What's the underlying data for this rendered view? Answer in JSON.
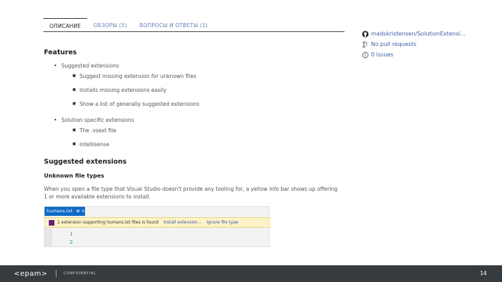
{
  "tabs": [
    {
      "label": "ОПИСАНИЕ",
      "active": true
    },
    {
      "label": "ОБЗОРЫ (5)",
      "active": false
    },
    {
      "label": "ВОПРОСЫ И ОТВЕТЫ (1)",
      "active": false
    }
  ],
  "sidebar": {
    "repo": "madskristensen/SolutionExtensi...",
    "pulls": "No pull requests",
    "issues": "0 issues"
  },
  "features": {
    "title": "Features",
    "groups": [
      {
        "label": "Suggested extensions",
        "items": [
          "Suggest missing extension for unknown files",
          "Installs missing extensions easily",
          "Show a list of generally suggested extensions"
        ]
      },
      {
        "label": "Solution specific extensions",
        "items": [
          "The .vsext file",
          "Intellisense"
        ]
      }
    ]
  },
  "suggested": {
    "title": "Suggested extensions",
    "subtitle": "Unknown file types",
    "description": "When you open a file type that Visual Studio doesn't provide any tooling for, a yellow info bar shows up offering 1 or more available extensions to install."
  },
  "screenshot": {
    "tab_label": "humans.txt",
    "tab_glyph": "⊕ ×",
    "bar_text": "1 extension supporting humans.txt files is found",
    "install_link": "Install extension...",
    "ignore_link": "Ignore file type",
    "lines": [
      "1",
      "2"
    ]
  },
  "footer": {
    "logo": "<epam>",
    "confidential": "CONFIDENTIAL",
    "page": "14"
  },
  "colors": {
    "link": "#3b5ea8",
    "accent_blue": "#0e6ac7",
    "infobar": "#fdf3c6",
    "footer_bg": "#363b40"
  }
}
